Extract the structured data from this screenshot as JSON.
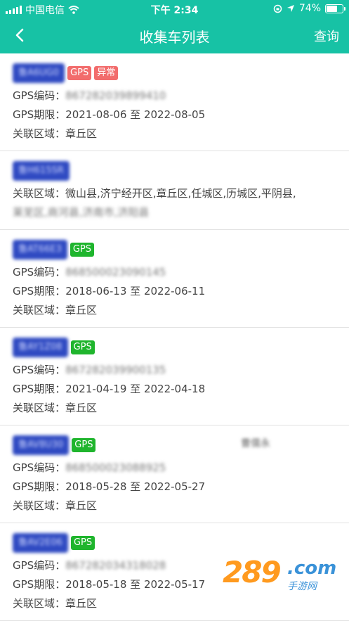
{
  "status_bar": {
    "carrier": "中国电信",
    "time": "下午 2:34",
    "battery_percent": "74%",
    "battery_level": 0.74
  },
  "nav": {
    "title": "收集车列表",
    "action": "查询"
  },
  "labels": {
    "gps_code": "GPS编码：",
    "gps_period": "GPS期限：",
    "area": "关联区域：",
    "period_sep": " 至 "
  },
  "vehicles": [
    {
      "plate": "鲁A6UG0",
      "tags": [
        {
          "text": "GPS",
          "kind": "gps-error"
        },
        {
          "text": "异常",
          "kind": "abnormal"
        }
      ],
      "gps_code": "867282039899410",
      "period_start": "2021-08-06",
      "period_end": "2022-08-05",
      "area": "章丘区"
    },
    {
      "plate": "鲁H615SR",
      "tags": [],
      "area": "微山县,济宁经开区,章丘区,任城区,历城区,平阴县,",
      "area_more": "莱芜区,商河县,济南市,济阳县"
    },
    {
      "plate": "鲁AT66E3",
      "tags": [
        {
          "text": "GPS",
          "kind": "gps-ok"
        }
      ],
      "gps_code": "868500023090145",
      "period_start": "2018-06-13",
      "period_end": "2022-06-11",
      "area": "章丘区"
    },
    {
      "plate": "鲁AY1Z08",
      "tags": [
        {
          "text": "GPS",
          "kind": "gps-ok"
        }
      ],
      "gps_code": "867282039900135",
      "period_start": "2021-04-19",
      "period_end": "2022-04-18",
      "area": "章丘区"
    },
    {
      "plate": "鲁AV8U30",
      "tags": [
        {
          "text": "GPS",
          "kind": "gps-ok"
        }
      ],
      "note": "曹儒永",
      "gps_code": "868500023088925",
      "period_start": "2018-05-28",
      "period_end": "2022-05-27",
      "area": "章丘区"
    },
    {
      "plate": "鲁AV2E06",
      "tags": [
        {
          "text": "GPS",
          "kind": "gps-ok"
        }
      ],
      "gps_code": "867282034318028",
      "period_start": "2018-05-18",
      "period_end": "2022-05-17",
      "area": "章丘区"
    }
  ],
  "watermark": {
    "number": "289",
    "suffix": ".com",
    "sub": "手游网"
  },
  "colors": {
    "header": "#17c2a5",
    "plate": "#2f4ac2",
    "tag_error": "#f26c6c",
    "tag_ok": "#1fb52d"
  }
}
